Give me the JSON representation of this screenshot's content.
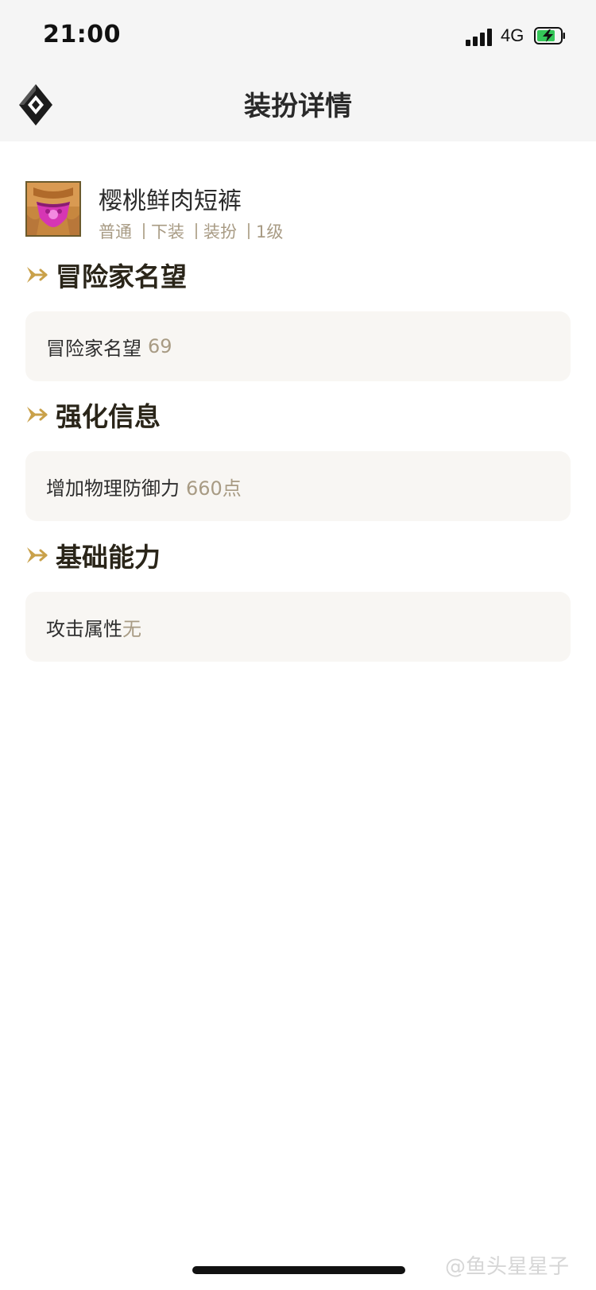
{
  "status_bar": {
    "time": "21:00",
    "network": "4G",
    "icons": [
      "signal-icon",
      "battery-charging-icon"
    ]
  },
  "header": {
    "title": "装扮详情",
    "logo_icon": "diamond-logo-icon"
  },
  "item": {
    "name": "樱桃鲜肉短裤",
    "meta": [
      "普通",
      "下装",
      "装扮",
      "1级"
    ],
    "thumbnail_icon": "shorts-thumbnail-icon"
  },
  "sections": [
    {
      "title": "冒险家名望",
      "card_label": "冒险家名望",
      "card_value": "69"
    },
    {
      "title": "强化信息",
      "card_label": "增加物理防御力",
      "card_value": "660点"
    },
    {
      "title": "基础能力",
      "card_label": "攻击属性",
      "card_value": "无"
    }
  ],
  "watermark": "@鱼头星星子",
  "colors": {
    "accent_gold": "#c9a14a",
    "meta_text": "#a89b84",
    "card_bg": "#f8f6f3",
    "header_bg": "#f5f5f5"
  }
}
